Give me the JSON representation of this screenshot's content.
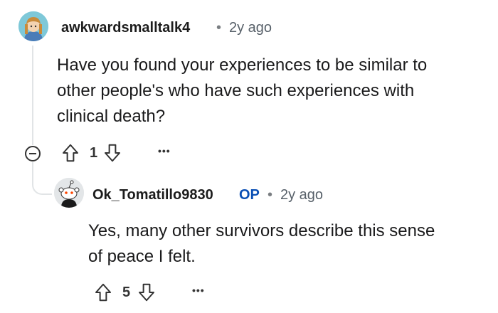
{
  "comment": {
    "username": "awkwardsmalltalk4",
    "separator": "•",
    "time": "2y ago",
    "body_lines": [
      "Have you found your experiences to be similar to",
      "other people's who have such experiences with",
      "clinical death?"
    ],
    "votes": "1",
    "more": "•••",
    "avatar_icon": "cartoon-avatar-icon",
    "colors": {
      "avatar_bg": "#7ec8d8",
      "hair": "#c98b3a"
    }
  },
  "reply": {
    "username": "Ok_Tomatillo9830",
    "op_badge": "OP",
    "separator": "•",
    "time": "2y ago",
    "body_lines": [
      "Yes, many other survivors describe this sense",
      "of peace I felt."
    ],
    "votes": "5",
    "more": "•••",
    "avatar_icon": "snoo-avatar-icon",
    "colors": {
      "op": "#0a4fb4"
    }
  }
}
